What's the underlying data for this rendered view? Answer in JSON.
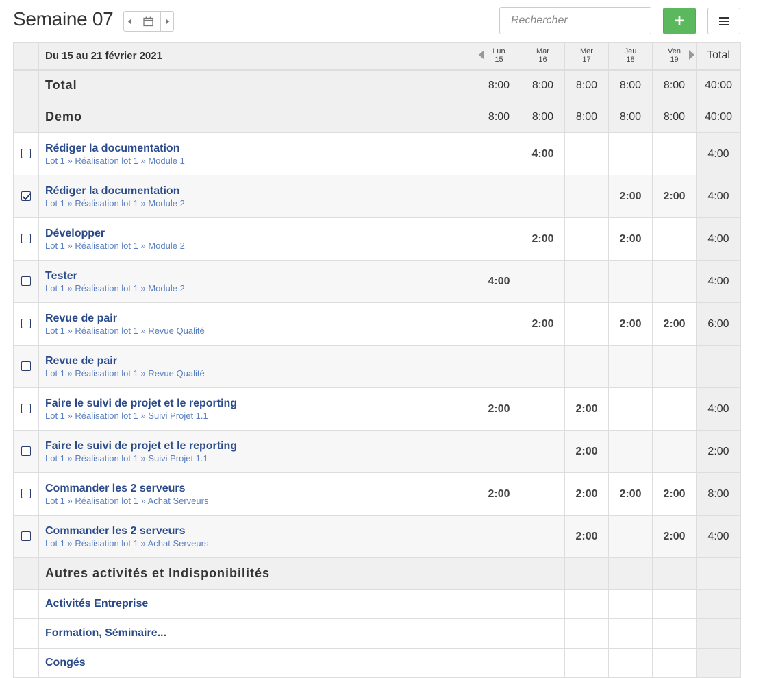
{
  "header": {
    "title": "Semaine 07",
    "search_placeholder": "Rechercher",
    "add_label": "+"
  },
  "grid": {
    "period": "Du 15 au 21 février 2021",
    "days": [
      {
        "name": "Lun",
        "num": "15"
      },
      {
        "name": "Mar",
        "num": "16"
      },
      {
        "name": "Mer",
        "num": "17"
      },
      {
        "name": "Jeu",
        "num": "18"
      },
      {
        "name": "Ven",
        "num": "19"
      }
    ],
    "total_label": "Total"
  },
  "summary": [
    {
      "label": "Total",
      "values": [
        "8:00",
        "8:00",
        "8:00",
        "8:00",
        "8:00"
      ],
      "total": "40:00"
    },
    {
      "label": "Demo",
      "values": [
        "8:00",
        "8:00",
        "8:00",
        "8:00",
        "8:00"
      ],
      "total": "40:00"
    }
  ],
  "tasks": [
    {
      "name": "Rédiger la documentation",
      "path": "Lot 1 » Réalisation lot 1 » Module 1",
      "checked": false,
      "hours": [
        "",
        "4:00",
        "",
        "",
        ""
      ],
      "total": "4:00"
    },
    {
      "name": "Rédiger la documentation",
      "path": "Lot 1 » Réalisation lot 1 » Module 2",
      "checked": true,
      "hours": [
        "",
        "",
        "",
        "2:00",
        "2:00"
      ],
      "total": "4:00"
    },
    {
      "name": "Développer",
      "path": "Lot 1 » Réalisation lot 1 » Module 2",
      "checked": false,
      "hours": [
        "",
        "2:00",
        "",
        "2:00",
        ""
      ],
      "total": "4:00"
    },
    {
      "name": "Tester",
      "path": "Lot 1 » Réalisation lot 1 » Module 2",
      "checked": false,
      "hours": [
        "4:00",
        "",
        "",
        "",
        ""
      ],
      "total": "4:00"
    },
    {
      "name": "Revue de pair",
      "path": "Lot 1 » Réalisation lot 1 » Revue Qualité",
      "checked": false,
      "hours": [
        "",
        "2:00",
        "",
        "2:00",
        "2:00"
      ],
      "total": "6:00"
    },
    {
      "name": "Revue de pair",
      "path": "Lot 1 » Réalisation lot 1 » Revue Qualité",
      "checked": false,
      "hours": [
        "",
        "",
        "",
        "",
        ""
      ],
      "total": ""
    },
    {
      "name": "Faire le suivi de projet et le reporting",
      "path": "Lot 1 » Réalisation lot 1 » Suivi Projet 1.1",
      "checked": false,
      "hours": [
        "2:00",
        "",
        "2:00",
        "",
        ""
      ],
      "total": "4:00"
    },
    {
      "name": "Faire le suivi de projet et le reporting",
      "path": "Lot 1 » Réalisation lot 1 » Suivi Projet 1.1",
      "checked": false,
      "hours": [
        "",
        "",
        "2:00",
        "",
        ""
      ],
      "total": "2:00"
    },
    {
      "name": "Commander les 2 serveurs",
      "path": "Lot 1 » Réalisation lot 1 » Achat Serveurs",
      "checked": false,
      "hours": [
        "2:00",
        "",
        "2:00",
        "2:00",
        "2:00"
      ],
      "total": "8:00"
    },
    {
      "name": "Commander les 2 serveurs",
      "path": "Lot 1 » Réalisation lot 1 » Achat Serveurs",
      "checked": false,
      "hours": [
        "",
        "",
        "2:00",
        "",
        "2:00"
      ],
      "total": "4:00"
    }
  ],
  "other_section": {
    "label": "Autres activités et Indisponibilités",
    "activities": [
      "Activités Entreprise",
      "Formation, Séminaire...",
      "Congés"
    ]
  }
}
